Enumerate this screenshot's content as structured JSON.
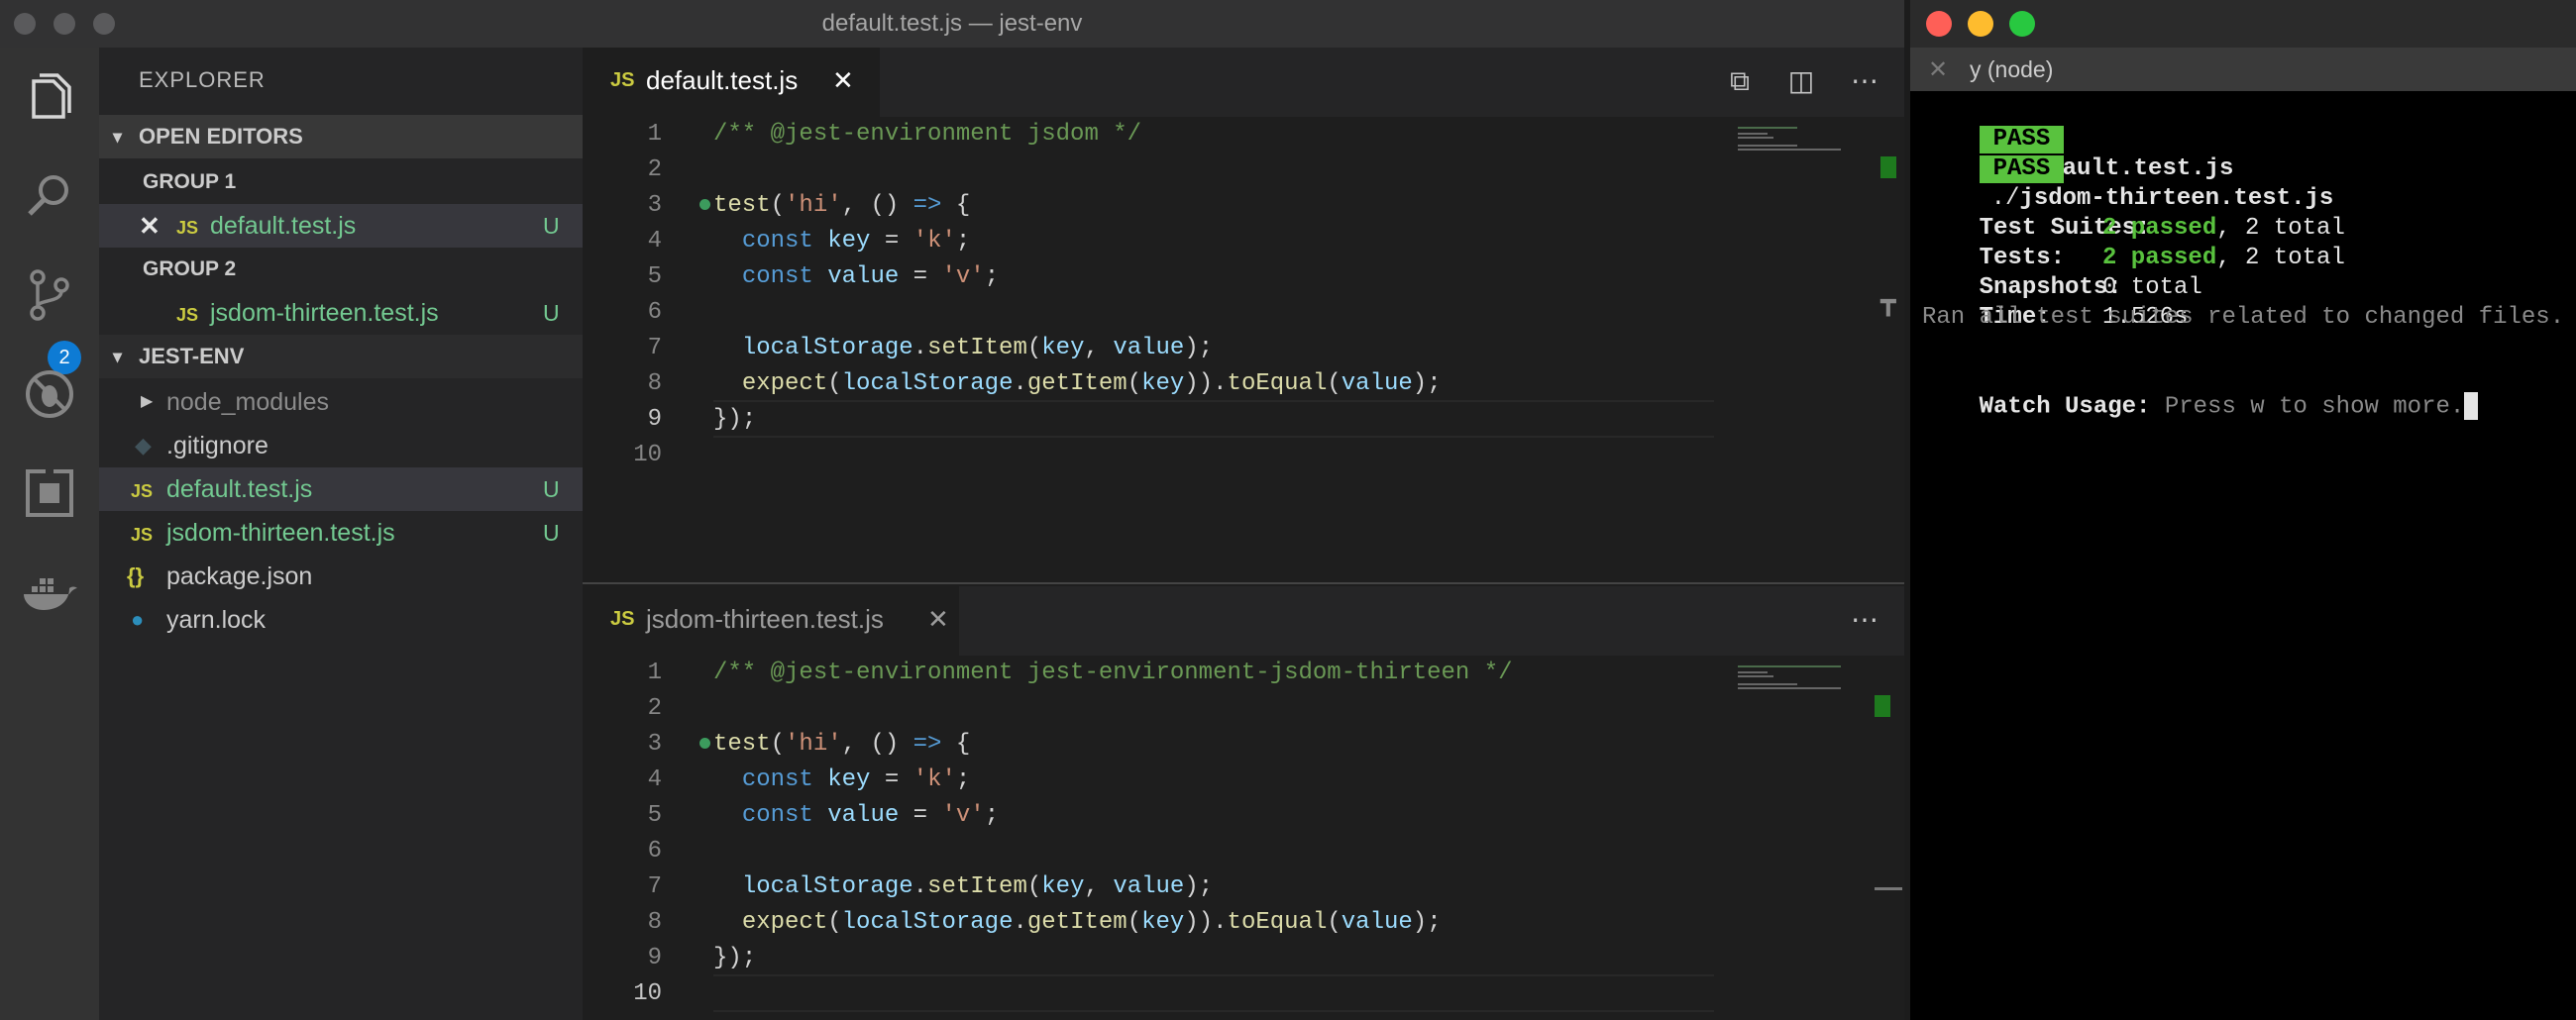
{
  "window": {
    "title": "default.test.js — jest-env"
  },
  "activity_bar": {
    "icons": [
      "files-icon",
      "search-icon",
      "source-control-icon",
      "debug-icon",
      "extensions-icon",
      "docker-icon"
    ],
    "scm_badge": "2"
  },
  "sidebar": {
    "title": "EXPLORER",
    "open_editors": {
      "header": "OPEN EDITORS",
      "groups": [
        {
          "label": "GROUP 1",
          "file": "default.test.js",
          "badge": "U"
        },
        {
          "label": "GROUP 2",
          "file": "jsdom-thirteen.test.js",
          "badge": "U"
        }
      ]
    },
    "project": {
      "header": "JEST-ENV",
      "items": [
        {
          "name": "node_modules",
          "badge": ""
        },
        {
          "name": ".gitignore",
          "badge": ""
        },
        {
          "name": "default.test.js",
          "badge": "U"
        },
        {
          "name": "jsdom-thirteen.test.js",
          "badge": "U"
        },
        {
          "name": "package.json",
          "badge": ""
        },
        {
          "name": "yarn.lock",
          "badge": ""
        }
      ]
    }
  },
  "editors": [
    {
      "tab_label": "default.test.js",
      "icon_text": "JS",
      "lines": [
        "/** @jest-environment jsdom */",
        "",
        "test('hi', () => {",
        "  const key = 'k';",
        "  const value = 'v';",
        "",
        "  localStorage.setItem(key, value);",
        "  expect(localStorage.getItem(key)).toEqual(value);",
        "});",
        ""
      ],
      "current_line": 9
    },
    {
      "tab_label": "jsdom-thirteen.test.js",
      "icon_text": "JS",
      "lines": [
        "/** @jest-environment jest-environment-jsdom-thirteen */",
        "",
        "test('hi', () => {",
        "  const key = 'k';",
        "  const value = 'v';",
        "",
        "  localStorage.setItem(key, value);",
        "  expect(localStorage.getItem(key)).toEqual(value);",
        "});",
        ""
      ],
      "current_line": 10
    }
  ],
  "terminal": {
    "tab_title": "y (node)",
    "results": [
      {
        "badge": "PASS",
        "path": "./",
        "file": "default.test.js"
      },
      {
        "badge": "PASS",
        "path": "./",
        "file": "jsdom-thirteen.test.js"
      }
    ],
    "summary": {
      "suites_label": "Test Suites:",
      "suites_passed": "2 passed",
      "suites_total": ", 2 total",
      "tests_label": "Tests:",
      "tests_passed": "2 passed",
      "tests_total": ", 2 total",
      "snapshots_label": "Snapshots:",
      "snapshots_value": "0 total",
      "time_label": "Time:",
      "time_value": "1.526s",
      "ran_msg": "Ran all test suites related to changed files."
    },
    "watch_label": "Watch Usage:",
    "watch_hint": "Press w to show more."
  }
}
